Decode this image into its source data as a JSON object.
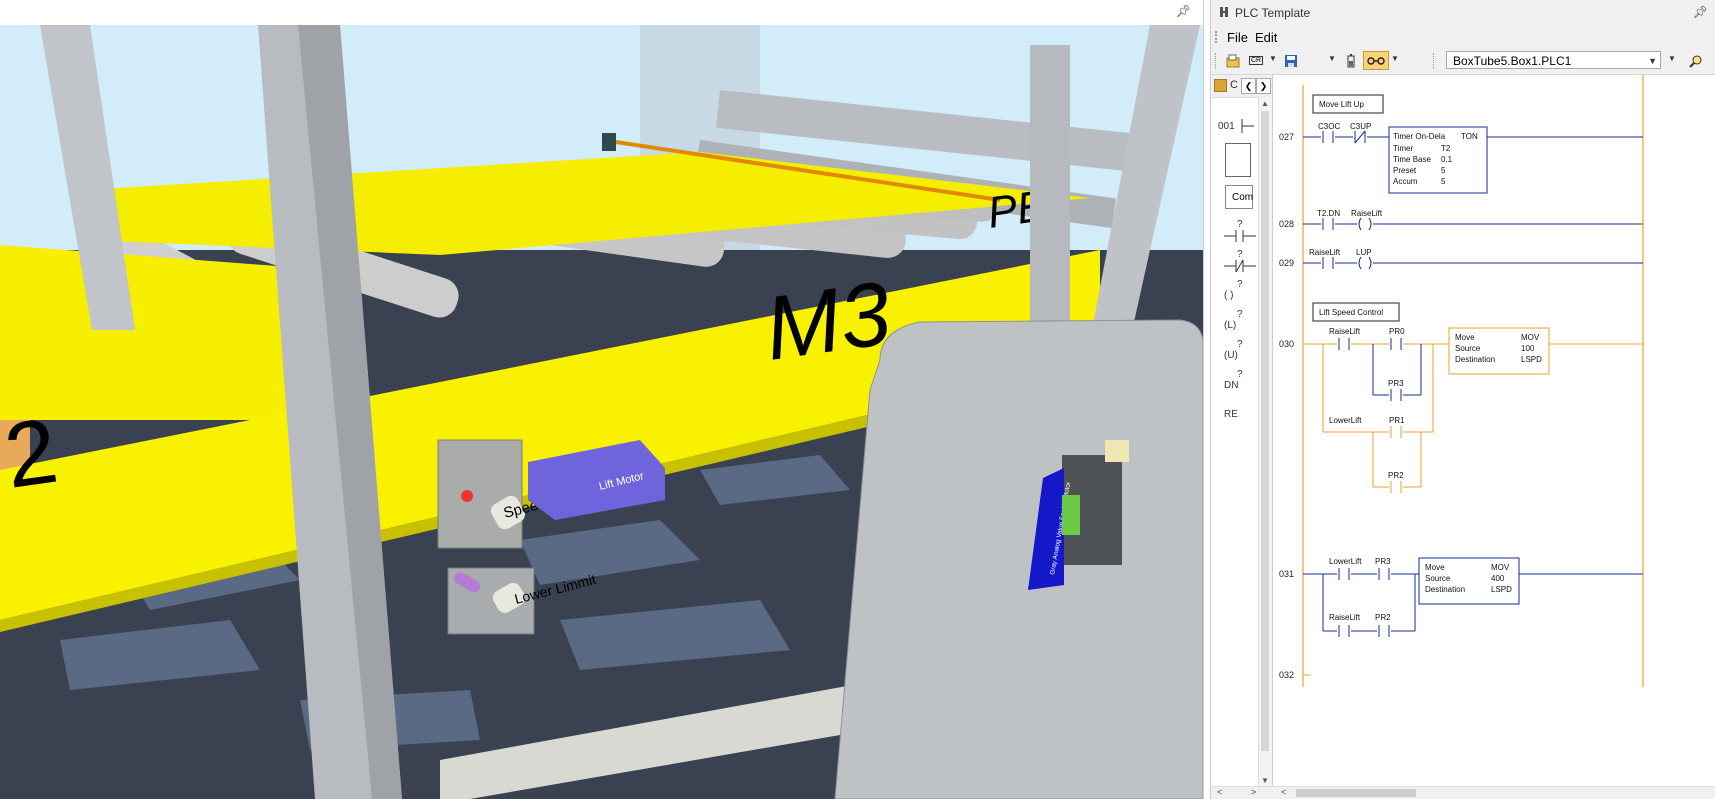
{
  "scene": {
    "labels": {
      "pe3": "PE3",
      "m3": "M3",
      "m2_partial": "2",
      "speed_change": "Speed Change",
      "lift_motor": "Lift Motor",
      "lower_limit": "Lower Limmit",
      "side_label": "Gray Analog Value For Lift Motor"
    },
    "colors": {
      "beam": "#f7f000",
      "frame": "#b7b9bc",
      "motor": "#6a5fd6",
      "sky": "#cfe9f7",
      "floor": "#2f3540"
    }
  },
  "plc": {
    "title": "PLC Template",
    "menu": [
      "File",
      "Edit"
    ],
    "toolbar": {
      "buttons": [
        "open-file-icon",
        "cr-icon",
        "save-icon",
        "battery-icon",
        "glasses-icon"
      ],
      "cr_label": "CR",
      "plc_select": "BoxTube5.Box1.PLC1"
    },
    "palette": {
      "header": "C",
      "rung_number": "001",
      "items": [
        "?",
        "?",
        "?",
        "?",
        "?",
        "?"
      ],
      "coil_labels": [
        "( )",
        "(L)",
        "(U)",
        "DN",
        "RE"
      ],
      "compare_label": "Com"
    },
    "rungs": [
      {
        "number": "027",
        "comment": "Move Lift Up",
        "contacts": [
          "C3OC",
          "C3UP"
        ],
        "block": {
          "title": "Timer On-Dela",
          "title2": "TON",
          "rows": [
            [
              "Timer",
              "T2"
            ],
            [
              "Time Base",
              "0.1"
            ],
            [
              "Preset",
              "5"
            ],
            [
              "Accum",
              "5"
            ]
          ]
        }
      },
      {
        "number": "028",
        "contacts": [
          "T2.DN"
        ],
        "coil": "RaiseLift"
      },
      {
        "number": "029",
        "contacts": [
          "RaiseLift"
        ],
        "coil": "LUP"
      },
      {
        "number": "030",
        "comment": "Lift Speed Control",
        "contacts": [
          "RaiseLift",
          "PR0",
          "PR3",
          "LowerLift",
          "PR1",
          "PR2"
        ],
        "block": {
          "title": "Move",
          "title2": "MOV",
          "rows": [
            [
              "Source",
              "100"
            ],
            [
              "Destination",
              "LSPD"
            ]
          ]
        }
      },
      {
        "number": "031",
        "contacts": [
          "LowerLift",
          "PR3",
          "RaiseLift",
          "PR2"
        ],
        "block": {
          "title": "Move",
          "title2": "MOV",
          "rows": [
            [
              "Source",
              "400"
            ],
            [
              "Destination",
              "LSPD"
            ]
          ]
        }
      },
      {
        "number": "032"
      }
    ]
  }
}
